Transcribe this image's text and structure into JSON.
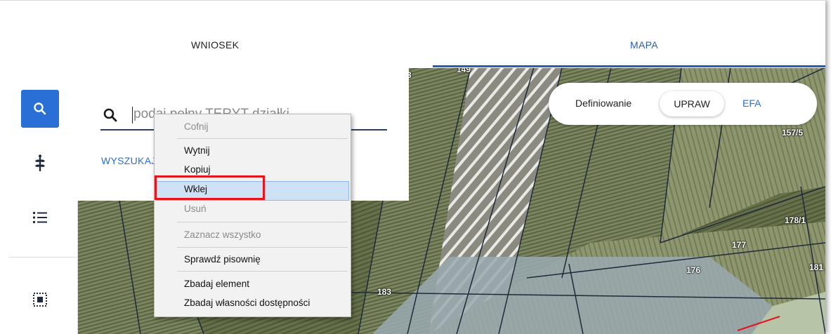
{
  "tabs": [
    {
      "label": "WNIOSEK",
      "active": false
    },
    {
      "label": "MAPA",
      "active": true
    }
  ],
  "search": {
    "placeholder": "podaj pełny TERYT działki",
    "button_label": "WYSZUKAJ"
  },
  "crop_toggle": {
    "label": "Definiowanie",
    "options": [
      "UPRAW",
      "EFA"
    ],
    "selected": "UPRAW"
  },
  "context_menu": {
    "items": [
      {
        "label": "Cofnij",
        "enabled": false
      },
      {
        "label": "Wytnij",
        "enabled": true
      },
      {
        "label": "Kopiuj",
        "enabled": true
      },
      {
        "label": "Wklej",
        "enabled": true,
        "highlighted": true
      },
      {
        "label": "Usuń",
        "enabled": false
      },
      {
        "label": "Zaznacz wszystko",
        "enabled": false
      },
      {
        "label": "Sprawdź pisownię",
        "enabled": true
      },
      {
        "label": "Zbadaj element",
        "enabled": true
      },
      {
        "label": "Zbadaj własności dostępności",
        "enabled": true
      }
    ]
  },
  "sidebar": {
    "icons": [
      "search-icon",
      "plant-icon",
      "list-icon",
      "select-area-icon"
    ]
  },
  "map": {
    "plot_labels": [
      "149",
      "157/5",
      "178/1",
      "177",
      "176",
      "181",
      "183",
      "3"
    ]
  },
  "colors": {
    "accent": "#2a6fd6",
    "highlight_box": "#e8141b",
    "menu_highlight": "#cfe1f5"
  }
}
